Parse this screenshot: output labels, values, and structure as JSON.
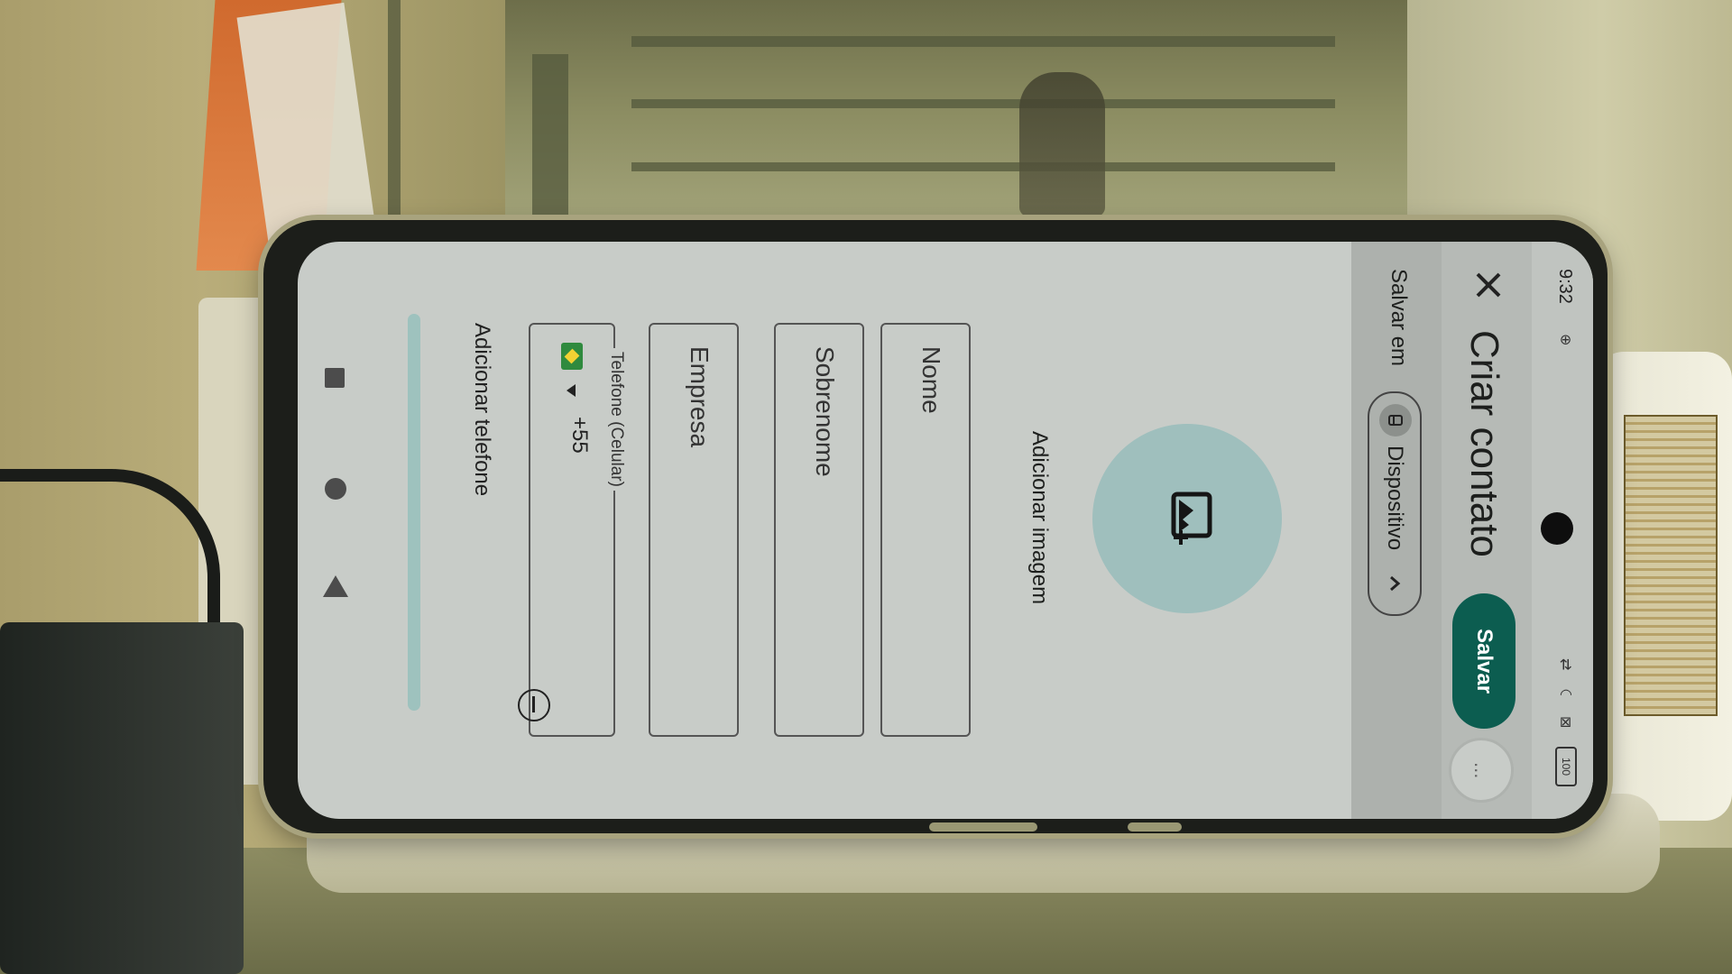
{
  "status_bar": {
    "time": "9:32",
    "battery": "100"
  },
  "toolbar": {
    "title": "Criar contato",
    "save_label": "Salvar",
    "more_label": "..."
  },
  "save_in": {
    "label": "Salvar em",
    "account": "Dispositivo"
  },
  "photo": {
    "add_image_label": "Adicionar imagem"
  },
  "form": {
    "first_name_placeholder": "Nome",
    "last_name_placeholder": "Sobrenome",
    "company_placeholder": "Empresa",
    "phone_label": "Telefone (Celular)",
    "country_code": "+55",
    "add_phone_label": "Adicionar telefone"
  },
  "colors": {
    "accent": "#0c5d50",
    "avatar_bg": "#9fbfbd",
    "screen_bg": "#c8ccc8"
  }
}
